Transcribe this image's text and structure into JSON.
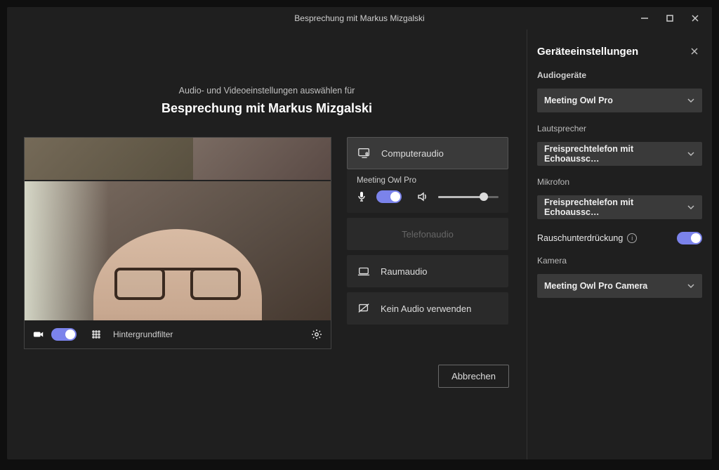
{
  "titlebar": {
    "title": "Besprechung mit Markus Mizgalski"
  },
  "subtitle": "Audio- und Videoeinstellungen auswählen für",
  "meeting_title": "Besprechung mit Markus Mizgalski",
  "preview_toolbar": {
    "filters_label": "Hintergrundfilter"
  },
  "audio_options": {
    "computer": "Computeraudio",
    "device_name": "Meeting Owl Pro",
    "phone": "Telefonaudio",
    "room": "Raumaudio",
    "none": "Kein Audio verwenden"
  },
  "cancel": "Abbrechen",
  "side": {
    "title": "Geräteeinstellungen",
    "audio_label": "Audiogeräte",
    "audio_value": "Meeting Owl Pro",
    "speaker_label": "Lautsprecher",
    "speaker_value": "Freisprechtelefon mit Echoaussc…",
    "mic_label": "Mikrofon",
    "mic_value": "Freisprechtelefon mit Echoaussc…",
    "noise_label": "Rauschunterdrückung",
    "camera_label": "Kamera",
    "camera_value": "Meeting Owl Pro Camera"
  }
}
